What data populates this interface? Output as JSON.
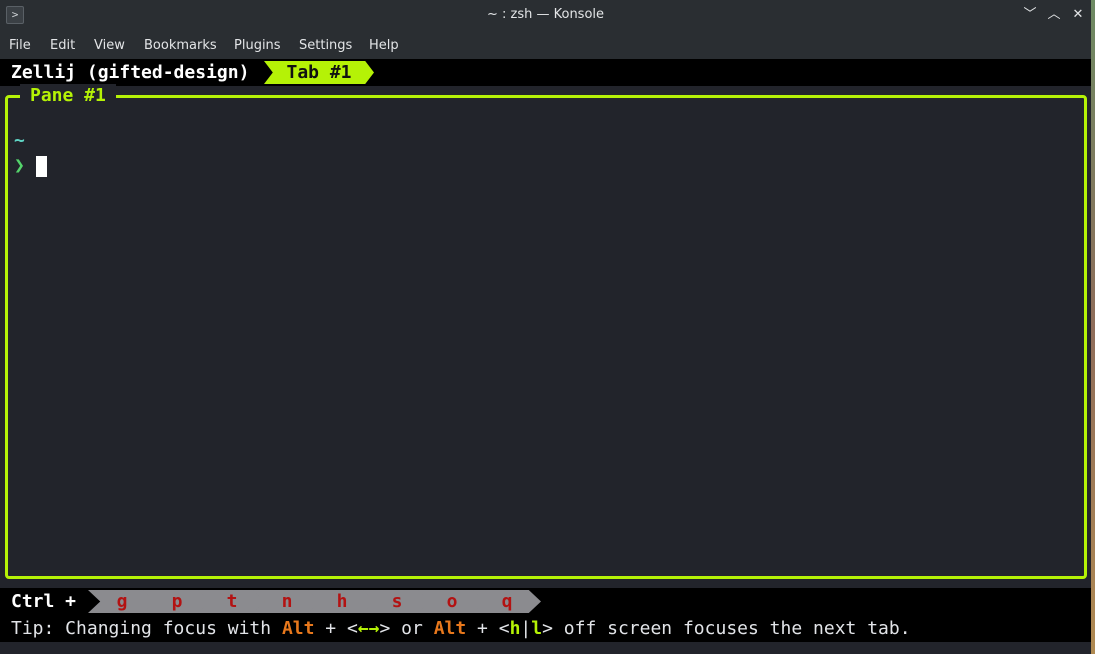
{
  "window": {
    "title": "~ : zsh — Konsole",
    "app_icon": ">",
    "minimize_icon": "﹀",
    "maximize_icon": "︿",
    "close_icon": "✕"
  },
  "menu": {
    "file": "File",
    "edit": "Edit",
    "view": "View",
    "bookmarks": "Bookmarks",
    "plugins": "Plugins",
    "settings": "Settings",
    "help": "Help"
  },
  "zellij": {
    "session": "Zellij (gifted-design)",
    "active_tab": "Tab #1",
    "pane_title": "Pane #1",
    "cwd": "~",
    "prompt": "❯"
  },
  "status": {
    "ctrl_label": "Ctrl +",
    "keys": [
      "g",
      "p",
      "t",
      "n",
      "h",
      "s",
      "o",
      "q"
    ]
  },
  "tip": {
    "prefix": "Tip: Changing focus with ",
    "alt1": "Alt",
    "plus1": " + <",
    "arrows": "←→",
    "middle": "> or ",
    "alt2": "Alt",
    "plus2": " + <",
    "h": "h",
    "pipe": "|",
    "l": "l",
    "suffix": "> off screen focuses the next tab."
  },
  "colors": {
    "accent_green": "#b5f206",
    "key_red": "#b31212",
    "tip_orange": "#e8781c",
    "terminal_bg": "#22242b"
  }
}
